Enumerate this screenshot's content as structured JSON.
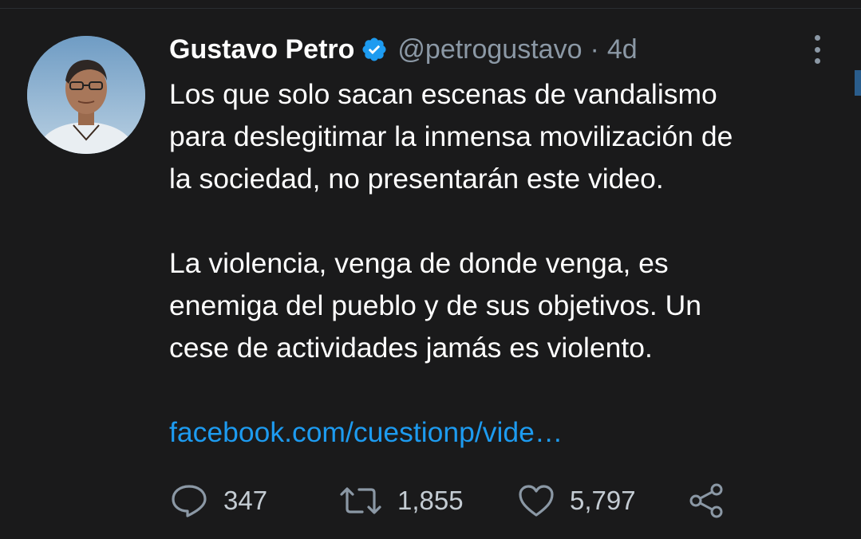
{
  "tweet": {
    "author": {
      "display_name": "Gustavo Petro",
      "handle": "@petrogustavo",
      "verified": true
    },
    "separator": "·",
    "timestamp": "4d",
    "paragraphs": [
      [
        "Los que solo sacan escenas de vandalismo",
        "para deslegitimar la inmensa movilización de",
        "la sociedad, no presentarán este video."
      ],
      [
        "La violencia, venga de donde venga, es",
        "enemiga del pueblo y de sus objetivos. Un",
        "cese de actividades jamás es violento."
      ]
    ],
    "link_text": "facebook.com/cuestionp/vide…",
    "actions": {
      "replies": "347",
      "retweets": "1,855",
      "likes": "5,797"
    }
  },
  "icons": {
    "verified": "verified-badge-icon",
    "more": "more-vertical-icon",
    "reply": "reply-bubble-icon",
    "retweet": "retweet-icon",
    "like": "heart-icon",
    "share": "share-icon"
  },
  "colors": {
    "background": "#1a1a1b",
    "text": "#ffffff",
    "muted": "#8b98a5",
    "link": "#1d9bf0",
    "verified": "#1d9bf0"
  }
}
